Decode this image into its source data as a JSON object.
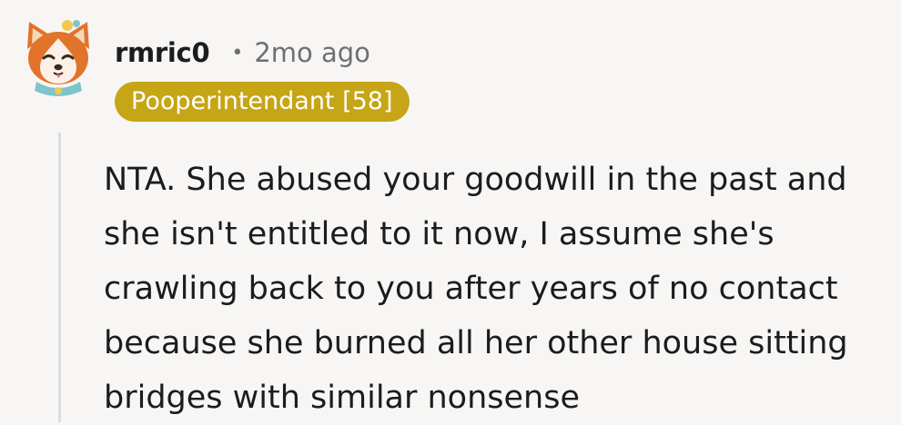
{
  "comment": {
    "username": "rmric0",
    "separator": "•",
    "timestamp": "2mo ago",
    "flair": "Pooperintendant [58]",
    "body": "NTA. She abused your goodwill in the past and she isn't entitled to it now, I assume she's crawling back to you after years of no contact because she burned all her other house sitting bridges with similar nonsense"
  },
  "colors": {
    "flair_bg": "#c6a516",
    "background": "#f7f6f5",
    "thread_line": "#dcdcdc"
  },
  "icons": {
    "avatar": "shiba-dog-avatar-icon"
  }
}
